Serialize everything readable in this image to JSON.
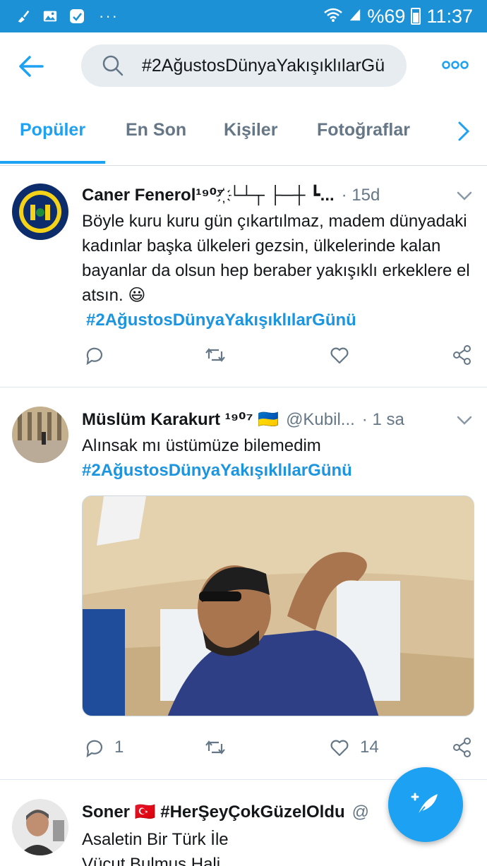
{
  "status_bar": {
    "icons": [
      "broom-icon",
      "image-icon",
      "shield-icon"
    ],
    "overflow": "···",
    "wifi": "wifi-icon",
    "signal": "signal-icon",
    "battery_text": "%69",
    "time": "11:37"
  },
  "header": {
    "back_icon": "back-arrow-icon",
    "search_query": "#2AğustosDünyaYakışıklılarGü",
    "more_icon": "more-icon"
  },
  "tabs": [
    {
      "label": "Popüler",
      "active": true
    },
    {
      "label": "En Son",
      "active": false
    },
    {
      "label": "Kişiler",
      "active": false
    },
    {
      "label": "Fotoğraflar",
      "active": false
    }
  ],
  "tweets": [
    {
      "name": "Caner Fenerol¹⁹⁰⁷҉ └┴┬ ├─┼ ┗...",
      "handle": "",
      "time": "· 15d",
      "text": "Böyle kuru kuru gün çıkartılmaz, madem dünyadaki kadınlar başka ülkeleri gezsin, ülkelerinde kalan bayanlar da olsun hep beraber yakışıklı erkeklere el atsın. 😃",
      "hashtag": "#2AğustosDünyaYakışıklılarGünü",
      "replies": "",
      "likes": ""
    },
    {
      "name": "Müslüm Karakurt ¹⁹⁰⁷ 🇺🇦",
      "handle": "@Kubil...",
      "time": "· 1 sa",
      "text": "Alınsak mı üstümüze bilemedim",
      "hashtag": "#2AğustosDünyaYakışıklılarGünü",
      "replies": "1",
      "likes": "14"
    },
    {
      "name": "Soner 🇹🇷 #HerŞeyÇokGüzelOldu",
      "handle": "@",
      "time": "",
      "text": "Asaletin Bir Türk İle Vücut Bulmuş Hali",
      "hashtag": "",
      "replies": "",
      "likes": ""
    }
  ],
  "colors": {
    "accent": "#1da1f2",
    "status_bar": "#1c91d6",
    "hashtag": "#1b95e0",
    "muted": "#657786"
  }
}
